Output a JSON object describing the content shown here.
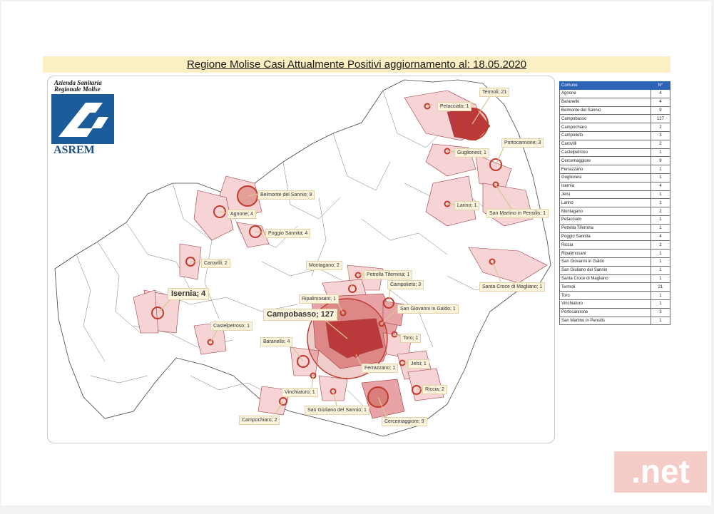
{
  "title": "Regione Molise Casi Attualmente Positivi aggiornamento al: 18.05.2020",
  "logo": {
    "org_line1": "Azienda Sanitaria",
    "org_line2": "Regionale Molise",
    "brand": "ASREM"
  },
  "watermark": ".net",
  "colors": {
    "accent": "#c0392b",
    "fill_light": "#f6d4d6",
    "fill_mid": "#e7a3a6",
    "fill_dark": "#b83a40",
    "header_blue": "#2e64b5",
    "title_bg": "#fcefc3"
  },
  "table": {
    "headers": [
      "Comune",
      "N°"
    ],
    "rows": [
      [
        "Agnone",
        "4"
      ],
      [
        "Baranello",
        "4"
      ],
      [
        "Belmonte del Sannio",
        "9"
      ],
      [
        "Campobasso",
        "127"
      ],
      [
        "Campochiaro",
        "2"
      ],
      [
        "Campolieto",
        "3"
      ],
      [
        "Carovilli",
        "2"
      ],
      [
        "Castelpetroso",
        "1"
      ],
      [
        "Cercemaggiore",
        "9"
      ],
      [
        "Ferrazzano",
        "1"
      ],
      [
        "Guglionesi",
        "1"
      ],
      [
        "Isernia",
        "4"
      ],
      [
        "Jelsi",
        "1"
      ],
      [
        "Larino",
        "1"
      ],
      [
        "Montagano",
        "2"
      ],
      [
        "Petacciato",
        "1"
      ],
      [
        "Petrella Tifernina",
        "1"
      ],
      [
        "Poggio Sannita",
        "4"
      ],
      [
        "Riccia",
        "2"
      ],
      [
        "Ripalimosani",
        "1"
      ],
      [
        "San Giovanni in Galdo",
        "1"
      ],
      [
        "San Giuliano del Sannio",
        "1"
      ],
      [
        "Santa Croce di Magliano",
        "1"
      ],
      [
        "Termoli",
        "21"
      ],
      [
        "Toro",
        "1"
      ],
      [
        "Vinchiaturo",
        "1"
      ],
      [
        "Portocannone",
        "3"
      ],
      [
        "San Martino in Pensilis",
        "1"
      ]
    ]
  },
  "labels": [
    {
      "id": "termoli",
      "text": "Termoli; 21",
      "cases": 21
    },
    {
      "id": "petacciato",
      "text": "Petacciato; 1",
      "cases": 1
    },
    {
      "id": "portocannone",
      "text": "Portocannone; 3",
      "cases": 3
    },
    {
      "id": "guglionesi",
      "text": "Guglionesi; 1",
      "cases": 1
    },
    {
      "id": "larino",
      "text": "Larino; 1",
      "cases": 1
    },
    {
      "id": "sanmartino",
      "text": "San Martino in Pensilis; 1",
      "cases": 1
    },
    {
      "id": "belmonte",
      "text": "Belmonte del Sannio; 9",
      "cases": 9
    },
    {
      "id": "agnone",
      "text": "Agnone; 4",
      "cases": 4
    },
    {
      "id": "poggio",
      "text": "Poggio Sannita; 4",
      "cases": 4
    },
    {
      "id": "carovilli",
      "text": "Carovilli; 2",
      "cases": 2
    },
    {
      "id": "isernia",
      "text": "Isernia; 4",
      "cases": 4
    },
    {
      "id": "castelpetroso",
      "text": "Castelpetroso; 1",
      "cases": 1
    },
    {
      "id": "montagano",
      "text": "Montagano; 2",
      "cases": 2
    },
    {
      "id": "petrella",
      "text": "Petrella Tifernina; 1",
      "cases": 1
    },
    {
      "id": "ripalimosani",
      "text": "Ripalimosani; 1",
      "cases": 1
    },
    {
      "id": "campolieto",
      "text": "Campolieto; 3",
      "cases": 3
    },
    {
      "id": "campobasso",
      "text": "Campobasso; 127",
      "cases": 127
    },
    {
      "id": "sangiovanni",
      "text": "San Giovanni in Galdo; 1",
      "cases": 1
    },
    {
      "id": "santacroce",
      "text": "Santa Croce di Magliano; 1",
      "cases": 1
    },
    {
      "id": "toro",
      "text": "Toro; 1",
      "cases": 1
    },
    {
      "id": "baranello",
      "text": "Baranello; 4",
      "cases": 4
    },
    {
      "id": "ferrazzano",
      "text": "Ferrazzano; 1",
      "cases": 1
    },
    {
      "id": "jelsi",
      "text": "Jelsi; 1",
      "cases": 1
    },
    {
      "id": "vinchiaturo",
      "text": "Vinchiaturo; 1",
      "cases": 1
    },
    {
      "id": "riccia",
      "text": "Riccia; 2",
      "cases": 2
    },
    {
      "id": "sangiuliano",
      "text": "San Giuliano del Sannio; 1",
      "cases": 1
    },
    {
      "id": "cercemaggiore",
      "text": "Cercemaggiore; 9",
      "cases": 9
    },
    {
      "id": "campochiaro",
      "text": "Campochiaro; 2",
      "cases": 2
    }
  ]
}
